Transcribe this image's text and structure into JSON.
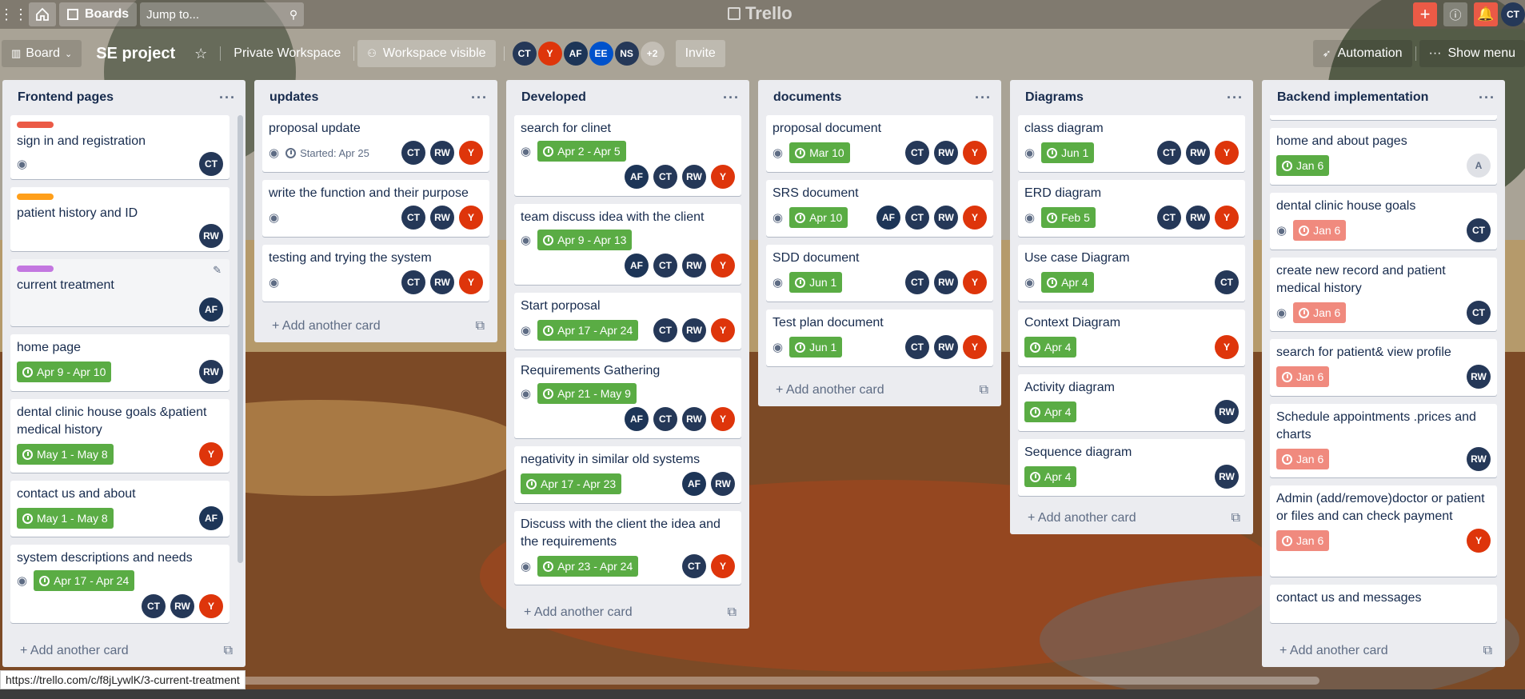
{
  "topbar": {
    "boards_label": "Boards",
    "search_placeholder": "Jump to...",
    "logo": "Trello",
    "user_initials": "CT"
  },
  "boardbar": {
    "view_label": "Board",
    "title": "SE project",
    "workspace_label": "Private Workspace",
    "visibility_label": "Workspace visible",
    "members": [
      "CT",
      "Y",
      "AF",
      "EE",
      "NS"
    ],
    "more_members": "+2",
    "invite_label": "Invite",
    "automation_label": "Automation",
    "show_menu_label": "Show menu"
  },
  "lists": [
    {
      "title": "Frontend pages",
      "add_label": "Add another card",
      "cards": [
        {
          "label_color": "#eb5a46",
          "title": "sign in and registration",
          "watch": true,
          "due": "",
          "members": [
            "CT"
          ]
        },
        {
          "label_color": "#ff9f1a",
          "title": "patient history and ID",
          "watch": false,
          "due": "",
          "members": [
            "RW"
          ]
        },
        {
          "label_color": "#c377e0",
          "title": "current treatment",
          "watch": false,
          "due": "",
          "members": [
            "AF"
          ]
        },
        {
          "label_color": "",
          "title": "home page",
          "watch": false,
          "due": "Apr 9 - Apr 10",
          "members": [
            "RW"
          ]
        },
        {
          "label_color": "",
          "title": "dental clinic house goals &patient medical history",
          "watch": false,
          "due": "May 1 - May 8",
          "members": [
            "Y"
          ]
        },
        {
          "label_color": "",
          "title": "contact us and about",
          "watch": false,
          "due": "May 1 - May 8",
          "members": [
            "AF"
          ]
        },
        {
          "label_color": "",
          "title": "system descriptions and needs",
          "watch": true,
          "due": "Apr 17 - Apr 24",
          "members": [
            "CT",
            "RW",
            "Y"
          ]
        }
      ]
    },
    {
      "title": "updates",
      "add_label": "Add another card",
      "cards": [
        {
          "title": "proposal update",
          "watch": true,
          "started": "Started: Apr 25",
          "due": "",
          "members": [
            "CT",
            "RW",
            "Y"
          ]
        },
        {
          "title": "write the function and their purpose",
          "watch": true,
          "due": "",
          "members": [
            "CT",
            "RW",
            "Y"
          ]
        },
        {
          "title": "testing and trying the system",
          "watch": true,
          "due": "",
          "members": [
            "CT",
            "RW",
            "Y"
          ]
        }
      ]
    },
    {
      "title": "Developed",
      "add_label": "Add another card",
      "cards": [
        {
          "title": "search for clinet",
          "watch": true,
          "due": "Apr 2 - Apr 5",
          "members": [
            "AF",
            "CT",
            "RW",
            "Y"
          ]
        },
        {
          "title": "team discuss idea with the client",
          "watch": true,
          "due": "Apr 9 - Apr 13",
          "members": [
            "AF",
            "CT",
            "RW",
            "Y"
          ]
        },
        {
          "title": "Start porposal",
          "watch": true,
          "due": "Apr 17 - Apr 24",
          "members": [
            "CT",
            "RW",
            "Y"
          ]
        },
        {
          "title": "Requirements Gathering",
          "watch": true,
          "due": "Apr 21 - May 9",
          "members": [
            "AF",
            "CT",
            "RW",
            "Y"
          ]
        },
        {
          "title": "negativity in similar old systems",
          "watch": false,
          "due": "Apr 17 - Apr 23",
          "members": [
            "AF",
            "RW"
          ]
        },
        {
          "title": "Discuss with the client the idea and the requirements",
          "watch": true,
          "due": "Apr 23 - Apr 24",
          "members": [
            "CT",
            "Y"
          ]
        }
      ]
    },
    {
      "title": "documents",
      "add_label": "Add another card",
      "cards": [
        {
          "title": "proposal document",
          "watch": true,
          "due": "Mar 10",
          "members": [
            "CT",
            "RW",
            "Y"
          ]
        },
        {
          "title": "SRS document",
          "watch": true,
          "due": "Apr 10",
          "members": [
            "AF",
            "CT",
            "RW",
            "Y"
          ]
        },
        {
          "title": "SDD document",
          "watch": true,
          "due": "Jun 1",
          "members": [
            "CT",
            "RW",
            "Y"
          ]
        },
        {
          "title": "Test plan document",
          "watch": true,
          "due": "Jun 1",
          "members": [
            "CT",
            "RW",
            "Y"
          ]
        }
      ]
    },
    {
      "title": "Diagrams",
      "add_label": "Add another card",
      "cards": [
        {
          "title": "class diagram",
          "watch": true,
          "due": "Jun 1",
          "members": [
            "CT",
            "RW",
            "Y"
          ]
        },
        {
          "title": "ERD diagram",
          "watch": true,
          "due": "Feb 5",
          "members": [
            "CT",
            "RW",
            "Y"
          ]
        },
        {
          "title": "Use case Diagram",
          "watch": true,
          "due": "Apr 4",
          "members": [
            "CT"
          ]
        },
        {
          "title": "Context Diagram",
          "watch": false,
          "due": "Apr 4",
          "members": [
            "Y"
          ]
        },
        {
          "title": "Activity diagram",
          "watch": false,
          "due": "Apr 4",
          "members": [
            "RW"
          ]
        },
        {
          "title": "Sequence diagram",
          "watch": false,
          "due": "Apr 4",
          "members": [
            "RW"
          ]
        }
      ]
    },
    {
      "title": "Backend implementation",
      "add_label": "Add another card",
      "cards": [
        {
          "title": "home and about pages",
          "watch": false,
          "due": "Jan 6",
          "due_color": "green",
          "members": [
            "A"
          ]
        },
        {
          "title": "dental clinic house goals",
          "watch": true,
          "due": "Jan 6",
          "due_color": "red",
          "members": [
            "CT"
          ]
        },
        {
          "title": "create new record and patient medical history",
          "watch": true,
          "due": "Jan 6",
          "due_color": "red",
          "members": [
            "CT"
          ]
        },
        {
          "title": "search for patient& view profile",
          "watch": false,
          "due": "Jan 6",
          "due_color": "red",
          "members": [
            "RW"
          ]
        },
        {
          "title": "Schedule appointments .prices and charts",
          "watch": false,
          "due": "Jan 6",
          "due_color": "red",
          "members": [
            "RW"
          ]
        },
        {
          "title": "Admin (add/remove)doctor or patient or files and can check payment",
          "watch": false,
          "due": "Jan 6",
          "due_color": "red",
          "members": [
            "Y"
          ]
        },
        {
          "title": "contact us and messages",
          "watch": false,
          "due": "",
          "members": []
        }
      ]
    }
  ],
  "status_url": "https://trello.com/c/f8jLywlK/3-current-treatment",
  "colors": {
    "due_green": "#5aac44",
    "due_red": "#f08a7e",
    "avatar_dark": "#253858",
    "avatar_red": "#de350b",
    "add_plus": "#eb5a46"
  }
}
